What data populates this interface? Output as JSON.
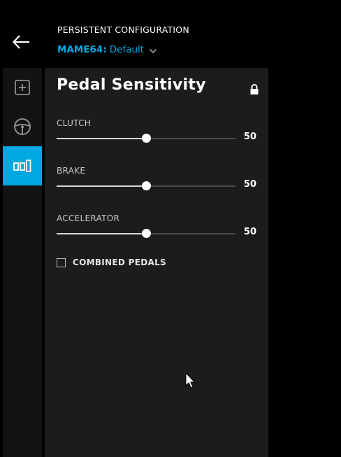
{
  "header": {
    "persistent_title": "PERSISTENT CONFIGURATION",
    "profile_game": "MAME64:",
    "profile_name": "Default",
    "accent_color": "#00a8e1"
  },
  "rail": {
    "items": [
      {
        "icon": "plus-square-icon",
        "active": false
      },
      {
        "icon": "steering-wheel-icon",
        "active": false
      },
      {
        "icon": "pedals-icon",
        "active": true
      }
    ]
  },
  "panel": {
    "title": "Pedal Sensitivity",
    "locked": true,
    "sliders": [
      {
        "label": "CLUTCH",
        "value": "50",
        "level": 50
      },
      {
        "label": "BRAKE",
        "value": "50",
        "level": 50
      },
      {
        "label": "ACCELERATOR",
        "value": "50",
        "level": 50
      }
    ],
    "combined_pedals": {
      "label": "COMBINED PEDALS",
      "checked": false
    }
  }
}
